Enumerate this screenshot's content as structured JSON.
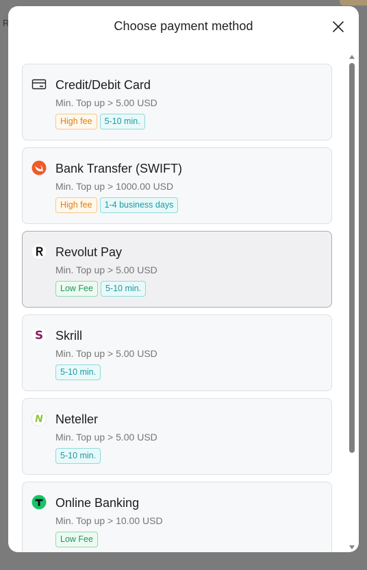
{
  "background": {
    "partial_text": "R"
  },
  "modal": {
    "title": "Choose payment method",
    "close_icon": "close-icon"
  },
  "methods": [
    {
      "name": "Credit/Debit Card",
      "icon": "credit-card-icon",
      "min": "Min. Top up > 5.00 USD",
      "tags": [
        {
          "label": "High fee",
          "tone": "orange"
        },
        {
          "label": "5-10 min.",
          "tone": "teal"
        }
      ]
    },
    {
      "name": "Bank Transfer (SWIFT)",
      "icon": "swift-icon",
      "min": "Min. Top up > 1000.00 USD",
      "tags": [
        {
          "label": "High fee",
          "tone": "orange"
        },
        {
          "label": "1-4 business days",
          "tone": "teal"
        }
      ]
    },
    {
      "name": "Revolut Pay",
      "icon": "revolut-icon",
      "min": "Min. Top up > 5.00 USD",
      "selected": true,
      "tags": [
        {
          "label": "Low Fee",
          "tone": "green"
        },
        {
          "label": "5-10 min.",
          "tone": "teal"
        }
      ]
    },
    {
      "name": "Skrill",
      "icon": "skrill-icon",
      "min": "Min. Top up > 5.00 USD",
      "tags": [
        {
          "label": "5-10 min.",
          "tone": "teal"
        }
      ]
    },
    {
      "name": "Neteller",
      "icon": "neteller-icon",
      "min": "Min. Top up > 5.00 USD",
      "tags": [
        {
          "label": "5-10 min.",
          "tone": "teal"
        }
      ]
    },
    {
      "name": "Online Banking",
      "icon": "online-banking-icon",
      "min": "Min. Top up > 10.00 USD",
      "tags": [
        {
          "label": "Low Fee",
          "tone": "green"
        }
      ]
    }
  ],
  "colors": {
    "orange_tag": "#e07e12",
    "teal_tag": "#1a9aa3",
    "green_tag": "#21955a",
    "swift_orange": "#f05a28",
    "skrill_purple": "#862165",
    "neteller_green": "#8dc63f",
    "online_banking_green": "#19c26b"
  }
}
